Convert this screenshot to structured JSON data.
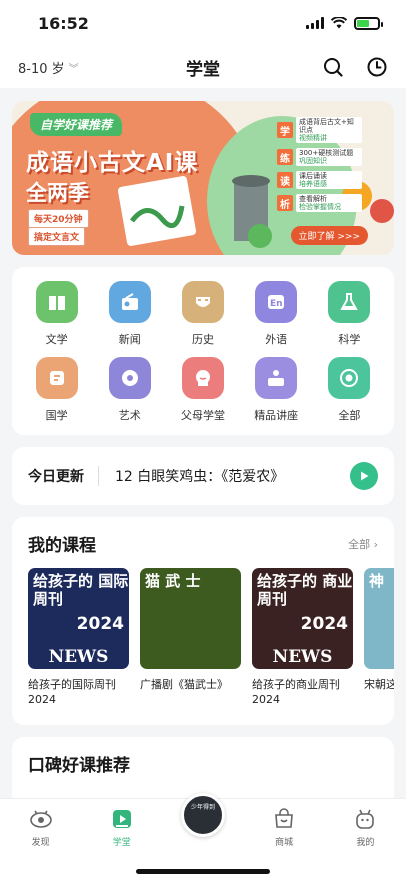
{
  "status_bar": {
    "time": "16:52",
    "battery_level": 0.6
  },
  "header": {
    "age_label": "8-10 岁",
    "title": "学堂"
  },
  "banner": {
    "tag": "自学好课推荐",
    "title": "成语小古文AI课",
    "subtitle": "全两季",
    "chips": [
      "每天20分钟",
      "搞定文言文"
    ],
    "steps": [
      {
        "key": "学",
        "line1": "成语背后古文+知识点",
        "line2": "视频精讲"
      },
      {
        "key": "练",
        "line1": "300+硬核测试题",
        "line2": "巩固知识"
      },
      {
        "key": "读",
        "line1": "课后诵读",
        "line2": "培养语感"
      },
      {
        "key": "析",
        "line1": "查看解析",
        "line2": "检验掌握情况"
      }
    ],
    "cta": "立即了解 >>>"
  },
  "categories": [
    {
      "label": "文学",
      "icon": "book-icon",
      "color": "#6cc36b"
    },
    {
      "label": "新闻",
      "icon": "radio-icon",
      "color": "#62a8e0"
    },
    {
      "label": "历史",
      "icon": "mask-icon",
      "color": "#d6b17a"
    },
    {
      "label": "外语",
      "icon": "language-icon",
      "color": "#8f86e0"
    },
    {
      "label": "科学",
      "icon": "flask-icon",
      "color": "#4fc38f"
    },
    {
      "label": "国学",
      "icon": "scroll-icon",
      "color": "#eba574"
    },
    {
      "label": "艺术",
      "icon": "palette-icon",
      "color": "#8e86d8"
    },
    {
      "label": "父母学堂",
      "icon": "parent-icon",
      "color": "#ec7d7d"
    },
    {
      "label": "精品讲座",
      "icon": "lecture-icon",
      "color": "#9b8ee0"
    },
    {
      "label": "全部",
      "icon": "all-icon",
      "color": "#4cc59d"
    }
  ],
  "today": {
    "label": "今日更新",
    "text": "12 白眼笑鸡虫：《范爱农》"
  },
  "my_courses": {
    "title": "我的课程",
    "more": "全部",
    "items": [
      {
        "title": "给孩子的国际周刊2024",
        "cover_text": "给孩子的 国际周刊",
        "cover_year": "2024",
        "cover_news": "NEWS",
        "color": "#1d2a5c"
      },
      {
        "title": "广播剧《猫武士》",
        "cover_text": "猫 武 士",
        "cover_year": "",
        "cover_news": "",
        "color": "#3d5a1f"
      },
      {
        "title": "给孩子的商业周刊2024",
        "cover_text": "给孩子的 商业周刊",
        "cover_year": "2024",
        "cover_news": "NEWS",
        "color": "#3b2222"
      },
      {
        "title": "宋朝这季｜神",
        "cover_text": "神",
        "cover_year": "",
        "cover_news": "",
        "color": "#7fb6c8"
      }
    ]
  },
  "recommend": {
    "title": "口碑好课推荐"
  },
  "tabbar": {
    "tabs": [
      {
        "label": "发现",
        "icon": "discover-icon"
      },
      {
        "label": "学堂",
        "icon": "school-icon"
      },
      {
        "label": "少年得到",
        "icon": "player-disc-icon"
      },
      {
        "label": "商城",
        "icon": "shop-icon"
      },
      {
        "label": "我的",
        "icon": "profile-icon"
      }
    ],
    "active": "学堂",
    "accent": "#34b57d"
  }
}
